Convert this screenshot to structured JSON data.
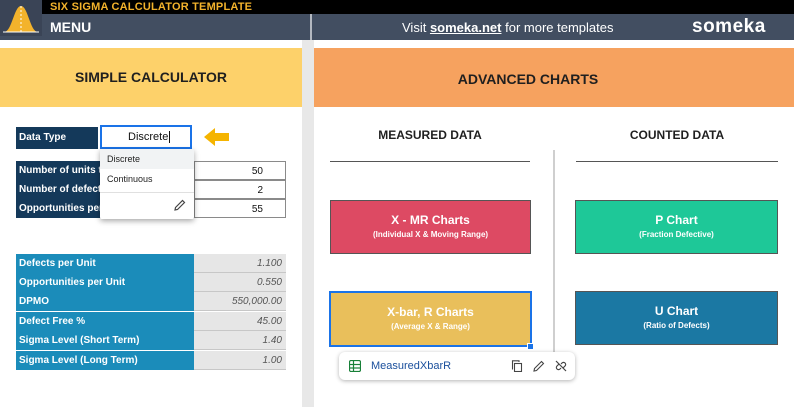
{
  "header": {
    "title": "SIX SIGMA CALCULATOR TEMPLATE",
    "menu_label": "MENU",
    "visit_prefix": "Visit ",
    "visit_link": "someka.net",
    "visit_suffix": " for more templates",
    "brand": "someka"
  },
  "simple_calculator": {
    "title": "SIMPLE CALCULATOR",
    "data_type_label": "Data Type",
    "data_type_value": "Discrete",
    "dropdown_options": [
      "Discrete",
      "Continuous"
    ],
    "inputs": [
      {
        "label": "Number of units to",
        "value": "50"
      },
      {
        "label": "Number of defects",
        "value": "2"
      },
      {
        "label": "Opportunities per",
        "value": "55"
      }
    ],
    "results": [
      {
        "label": "Defects per Unit",
        "value": "1.100"
      },
      {
        "label": "Opportunities per Unit",
        "value": "0.550"
      },
      {
        "label": "DPMO",
        "value": "550,000.00"
      },
      {
        "label": "Defect Free %",
        "value": "45.00"
      },
      {
        "label": "Sigma Level (Short Term)",
        "value": "1.40"
      },
      {
        "label": "Sigma Level (Long Term)",
        "value": "1.00"
      }
    ]
  },
  "advanced_charts": {
    "title": "ADVANCED CHARTS",
    "measured_heading": "MEASURED DATA",
    "counted_heading": "COUNTED DATA",
    "buttons": [
      {
        "title": "X - MR Charts",
        "subtitle": "(Individual X & Moving Range)",
        "color": "#dd4a63"
      },
      {
        "title": "X-bar, R Charts",
        "subtitle": "(Average X & Range)",
        "color": "#e9bf5b"
      },
      {
        "title": "P Chart",
        "subtitle": "(Fraction Defective)",
        "color": "#1ec898"
      },
      {
        "title": "U Chart",
        "subtitle": "(Ratio of Defects)",
        "color": "#1b78a3"
      }
    ]
  },
  "link_chip": {
    "label": "MeasuredXbarR",
    "icons": [
      "sheets-icon",
      "copy-icon",
      "edit-icon",
      "unlink-icon"
    ]
  }
}
